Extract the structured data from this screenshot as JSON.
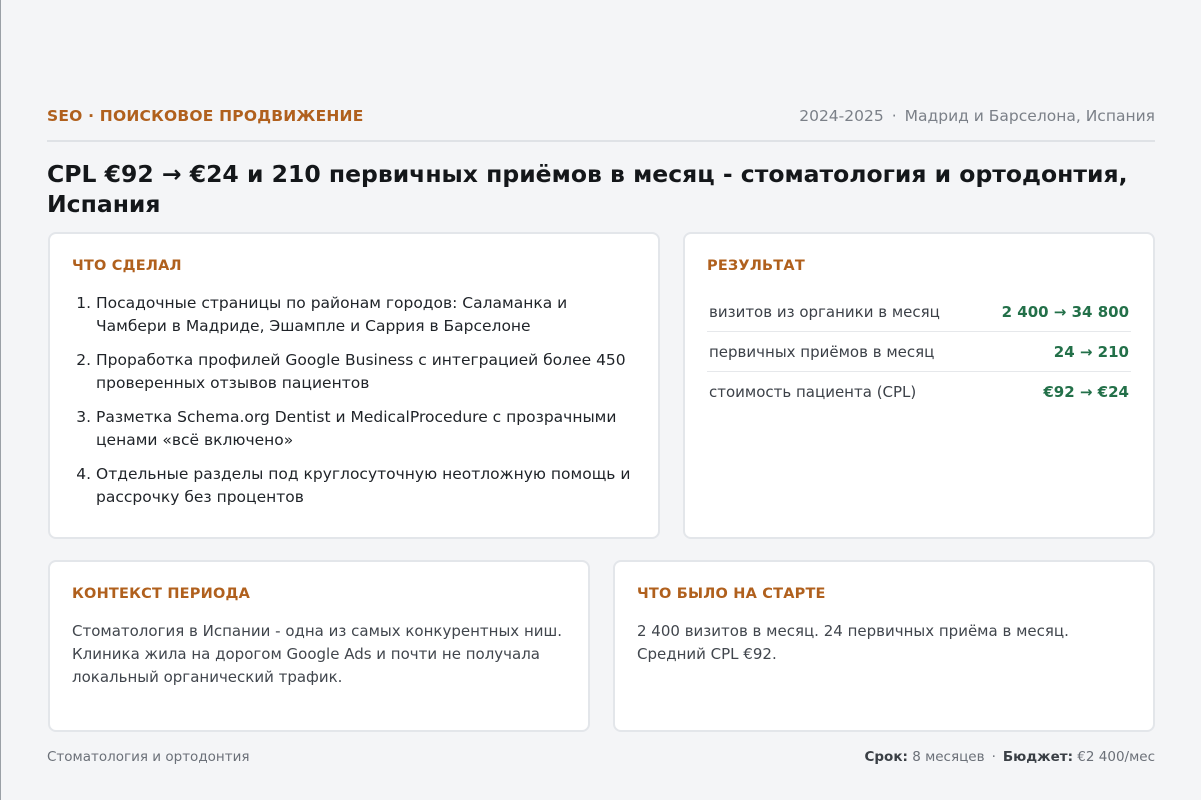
{
  "header": {
    "eyebrow": "SEO · ПОИСКОВОЕ ПРОДВИЖЕНИЕ",
    "years": "2024-2025",
    "meta_separator": "·",
    "location": "Мадрид и Барселона, Испания"
  },
  "title": "CPL €92 → €24 и 210 первичных приёмов в месяц - стоматология и ортодонтия, Испания",
  "done": {
    "label": "ЧТО СДЕЛАЛ",
    "items": [
      "Посадочные страницы по районам городов: Саламанка и Чамбери в Мадриде, Эшампле и Саррия в Барселоне",
      "Проработка профилей Google Business с интеграцией более 450 проверенных отзывов пациентов",
      "Разметка Schema.org Dentist и MedicalProcedure с прозрачными ценами «всё включено»",
      "Отдельные разделы под круглосуточную неотложную помощь и рассрочку без процентов"
    ]
  },
  "result": {
    "label": "РЕЗУЛЬТАТ",
    "rows": [
      {
        "label": "визитов из органики в месяц",
        "value": "2 400 → 34 800"
      },
      {
        "label": "первичных приёмов в месяц",
        "value": "24 → 210"
      },
      {
        "label": "стоимость пациента (CPL)",
        "value": "€92 → €24"
      }
    ]
  },
  "context": {
    "label": "КОНТЕКСТ ПЕРИОДА",
    "text": "Стоматология в Испании - одна из самых конкурентных ниш. Клиника жила на дорогом Google Ads и почти не получала локальный органический трафик."
  },
  "start": {
    "label": "ЧТО БЫЛО НА СТАРТЕ",
    "text": "2 400 визитов в месяц. 24 первичных приёма в месяц. Средний CPL €92."
  },
  "footer": {
    "category": "Стоматология и ортодонтия",
    "term_label": "Срок:",
    "term_value": "8 месяцев",
    "separator": "·",
    "budget_label": "Бюджет:",
    "budget_value": "€2 400/мес"
  },
  "colors": {
    "accent": "#b0601d",
    "result_value": "#237049",
    "background": "#f4f5f7"
  }
}
